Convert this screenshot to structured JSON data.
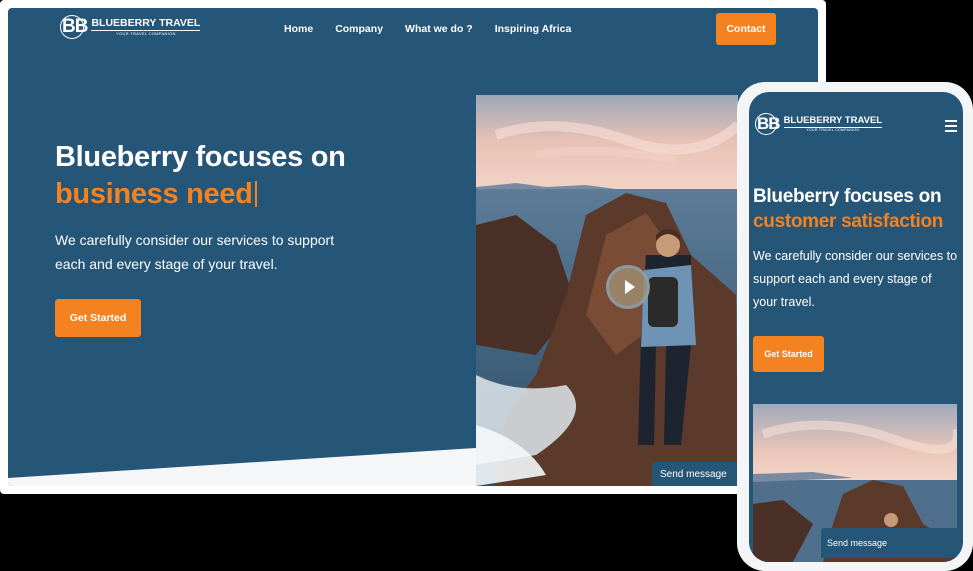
{
  "brand": {
    "logo_mark": "BB",
    "name": "BLUEBERRY TRAVEL",
    "tagline": "YOUR TRAVEL COMPANION"
  },
  "desktop": {
    "nav": {
      "items": [
        "Home",
        "Company",
        "What we do ?",
        "Inspiring Africa"
      ],
      "contact_label": "Contact"
    },
    "hero": {
      "headline": "Blueberry focuses on",
      "headline_accent": "business need",
      "description": "We carefully consider our services to support each and every stage of your travel.",
      "cta_label": "Get Started"
    },
    "send_message_label": "Send message"
  },
  "mobile": {
    "hero": {
      "headline": "Blueberry focuses on",
      "headline_accent": "customer satisfaction",
      "description": "We carefully consider our services to support each and every stage of your travel.",
      "cta_label": "Get Started"
    },
    "send_message_label": "Send message"
  },
  "colors": {
    "navy": "#255577",
    "orange": "#f58220",
    "white": "#ffffff"
  },
  "icons": [
    "play-icon",
    "hamburger-menu-icon",
    "globe-icon"
  ]
}
